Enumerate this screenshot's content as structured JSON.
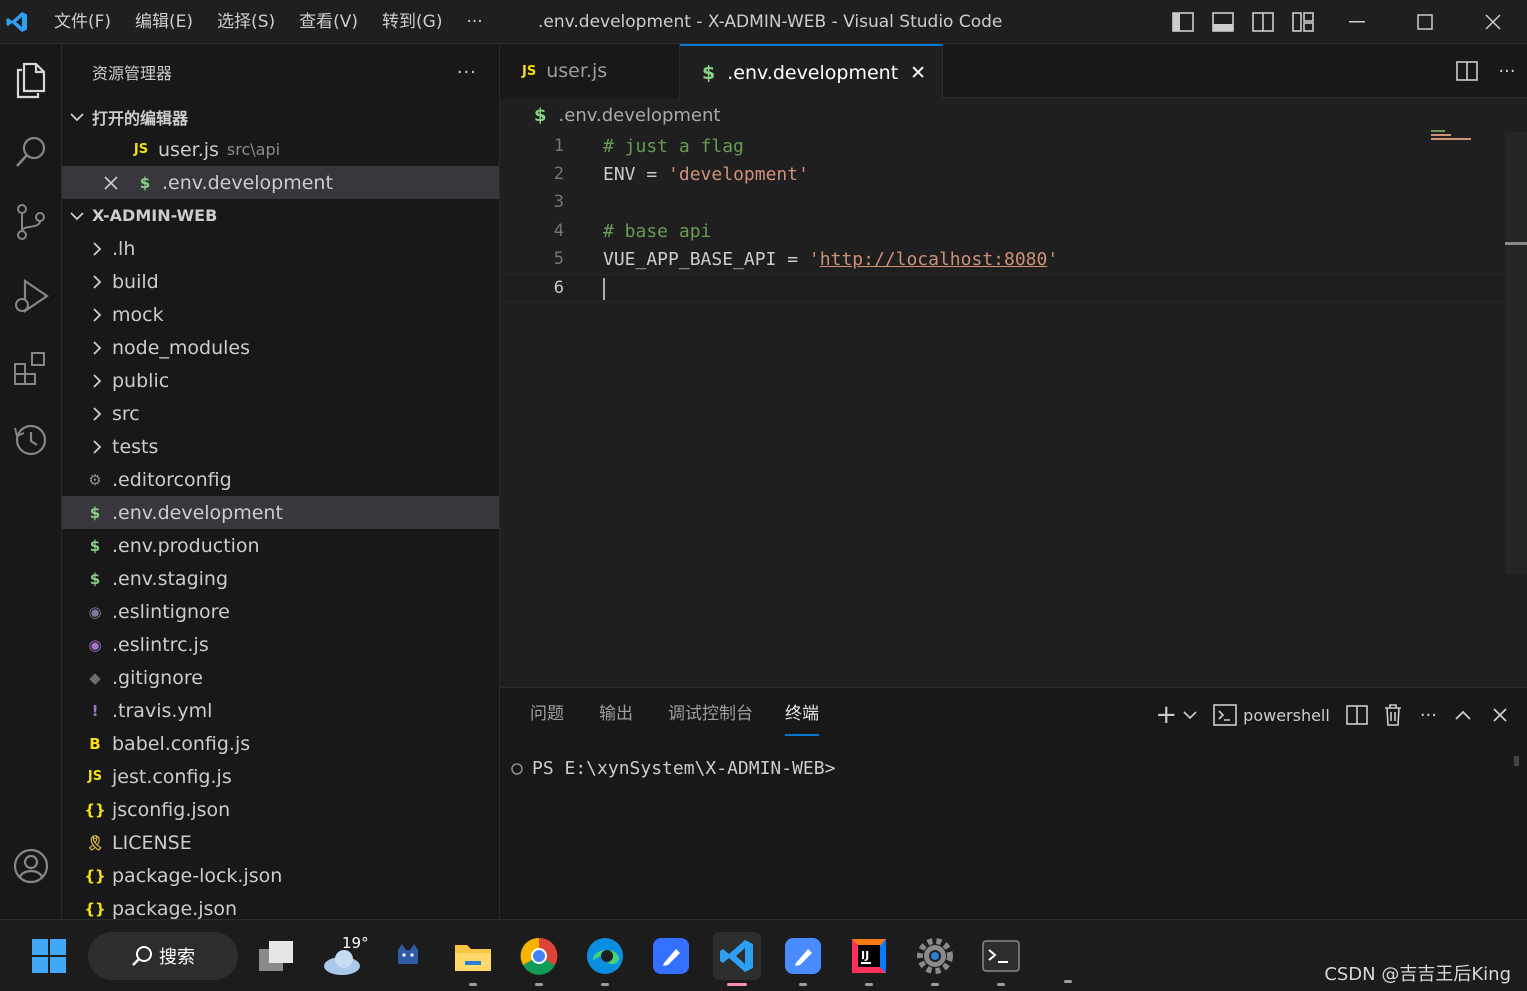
{
  "titlebar": {
    "menus": [
      "文件(F)",
      "编辑(E)",
      "选择(S)",
      "查看(V)",
      "转到(G)",
      "···"
    ],
    "title": ".env.development - X-ADMIN-WEB - Visual Studio Code"
  },
  "sidebar": {
    "title": "资源管理器",
    "more": "···",
    "open_editors_label": "打开的编辑器",
    "open_editors": [
      {
        "icon": "JS",
        "name": "user.js",
        "desc": "src\\api"
      },
      {
        "icon": "$",
        "name": ".env.development",
        "desc": ""
      }
    ],
    "project_label": "X-ADMIN-WEB",
    "folders": [
      ".lh",
      "build",
      "mock",
      "node_modules",
      "public",
      "src",
      "tests"
    ],
    "files": [
      {
        "icon": "⚙",
        "name": ".editorconfig",
        "color": "#8c8c8c"
      },
      {
        "icon": "$",
        "name": ".env.development",
        "color": "#89d185"
      },
      {
        "icon": "$",
        "name": ".env.production",
        "color": "#89d185"
      },
      {
        "icon": "$",
        "name": ".env.staging",
        "color": "#89d185"
      },
      {
        "icon": "◉",
        "name": ".eslintignore",
        "color": "#7a7a9a"
      },
      {
        "icon": "◉",
        "name": ".eslintrc.js",
        "color": "#a074c4"
      },
      {
        "icon": "◆",
        "name": ".gitignore",
        "color": "#6d6d6d"
      },
      {
        "icon": "!",
        "name": ".travis.yml",
        "color": "#a074c4"
      },
      {
        "icon": "B",
        "name": "babel.config.js",
        "color": "#f5de19"
      },
      {
        "icon": "JS",
        "name": "jest.config.js",
        "color": "#f5de19"
      },
      {
        "icon": "{}",
        "name": "jsconfig.json",
        "color": "#f5de19"
      },
      {
        "icon": "🎗",
        "name": "LICENSE",
        "color": "#d4b44a"
      },
      {
        "icon": "{}",
        "name": "package-lock.json",
        "color": "#f5de19"
      },
      {
        "icon": "{}",
        "name": "package.json",
        "color": "#f5de19"
      }
    ]
  },
  "editor": {
    "tabs": [
      {
        "icon": "JS",
        "label": "user.js"
      },
      {
        "icon": "$",
        "label": ".env.development",
        "close": "✕"
      }
    ],
    "breadcrumb": ".env.development",
    "lines": [
      {
        "n": "1",
        "text": "# just a flag"
      },
      {
        "n": "2",
        "text": "ENV = 'development'"
      },
      {
        "n": "3",
        "text": ""
      },
      {
        "n": "4",
        "text": "# base api"
      },
      {
        "n": "5",
        "text": "VUE_APP_BASE_API = 'http://localhost:8080'"
      },
      {
        "n": "6",
        "text": ""
      }
    ],
    "code": {
      "env_key": "ENV",
      "env_val": "'development'",
      "api_key": "VUE_APP_BASE_API",
      "eq": "=",
      "quote": "'",
      "url": "http://localhost:8080"
    }
  },
  "panel": {
    "tabs": [
      "问题",
      "输出",
      "调试控制台",
      "终端"
    ],
    "active_tab": "终端",
    "shell": "powershell",
    "prompt": "PS E:\\xynSystem\\X-ADMIN-WEB>"
  },
  "taskbar": {
    "search": "搜索",
    "weather": "19°",
    "watermark": "CSDN @吉吉王后King"
  },
  "colors": {
    "accent": "#0078d4",
    "comment": "#6a9955",
    "string": "#ce9178",
    "js_icon": "#f5de19",
    "env_icon": "#89d185"
  }
}
